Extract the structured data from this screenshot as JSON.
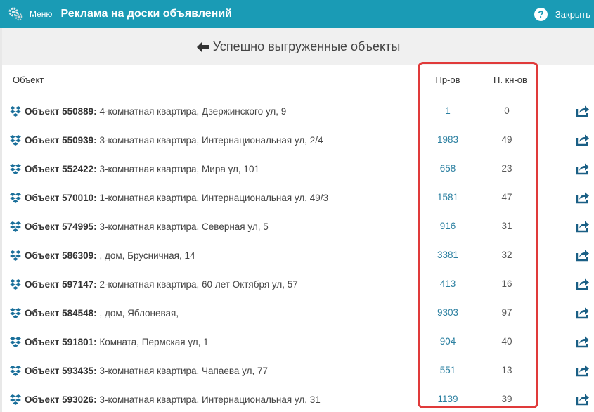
{
  "topbar": {
    "menu_label": "Меню",
    "title": "Реклама на доски объявлений",
    "help_glyph": "?",
    "close_label": "Закрыть",
    "background": "#1a9bb5"
  },
  "page": {
    "title": "Успешно выгруженные объекты"
  },
  "table": {
    "headers": {
      "object": "Объект",
      "views": "Пр-ов",
      "calls": "П. кн-ов"
    },
    "rows": [
      {
        "name": "Объект 550889:",
        "desc": " 4-комнатная квартира, Дзержинского ул, 9",
        "views": "1",
        "calls": "0"
      },
      {
        "name": "Объект 550939:",
        "desc": " 3-комнатная квартира, Интернациональная ул, 2/4",
        "views": "1983",
        "calls": "49"
      },
      {
        "name": "Объект 552422:",
        "desc": " 3-комнатная квартира, Мира ул, 101",
        "views": "658",
        "calls": "23"
      },
      {
        "name": "Объект 570010:",
        "desc": " 1-комнатная квартира, Интернациональная ул, 49/3",
        "views": "1581",
        "calls": "47"
      },
      {
        "name": "Объект 574995:",
        "desc": " 3-комнатная квартира, Северная ул, 5",
        "views": "916",
        "calls": "31"
      },
      {
        "name": "Объект 586309:",
        "desc": " , дом, Брусничная, 14",
        "views": "3381",
        "calls": "32"
      },
      {
        "name": "Объект 597147:",
        "desc": " 2-комнатная квартира, 60 лет Октября ул, 57",
        "views": "413",
        "calls": "16"
      },
      {
        "name": "Объект 584548:",
        "desc": " , дом, Яблоневая,",
        "views": "9303",
        "calls": "97"
      },
      {
        "name": "Объект 591801:",
        "desc": " Комната, Пермская ул, 1",
        "views": "904",
        "calls": "40"
      },
      {
        "name": "Объект 593435:",
        "desc": " 3-комнатная квартира, Чапаева ул, 77",
        "views": "551",
        "calls": "13"
      },
      {
        "name": "Объект 593026:",
        "desc": " 3-комнатная квартира, Интернациональная ул, 31",
        "views": "1139",
        "calls": "39"
      }
    ]
  },
  "icons": {
    "menu": "gears-icon",
    "help": "help-icon",
    "back": "arrow-left-icon",
    "object": "stacked-boxes-icon",
    "share": "share-icon"
  },
  "highlight_color": "#e03a3a"
}
